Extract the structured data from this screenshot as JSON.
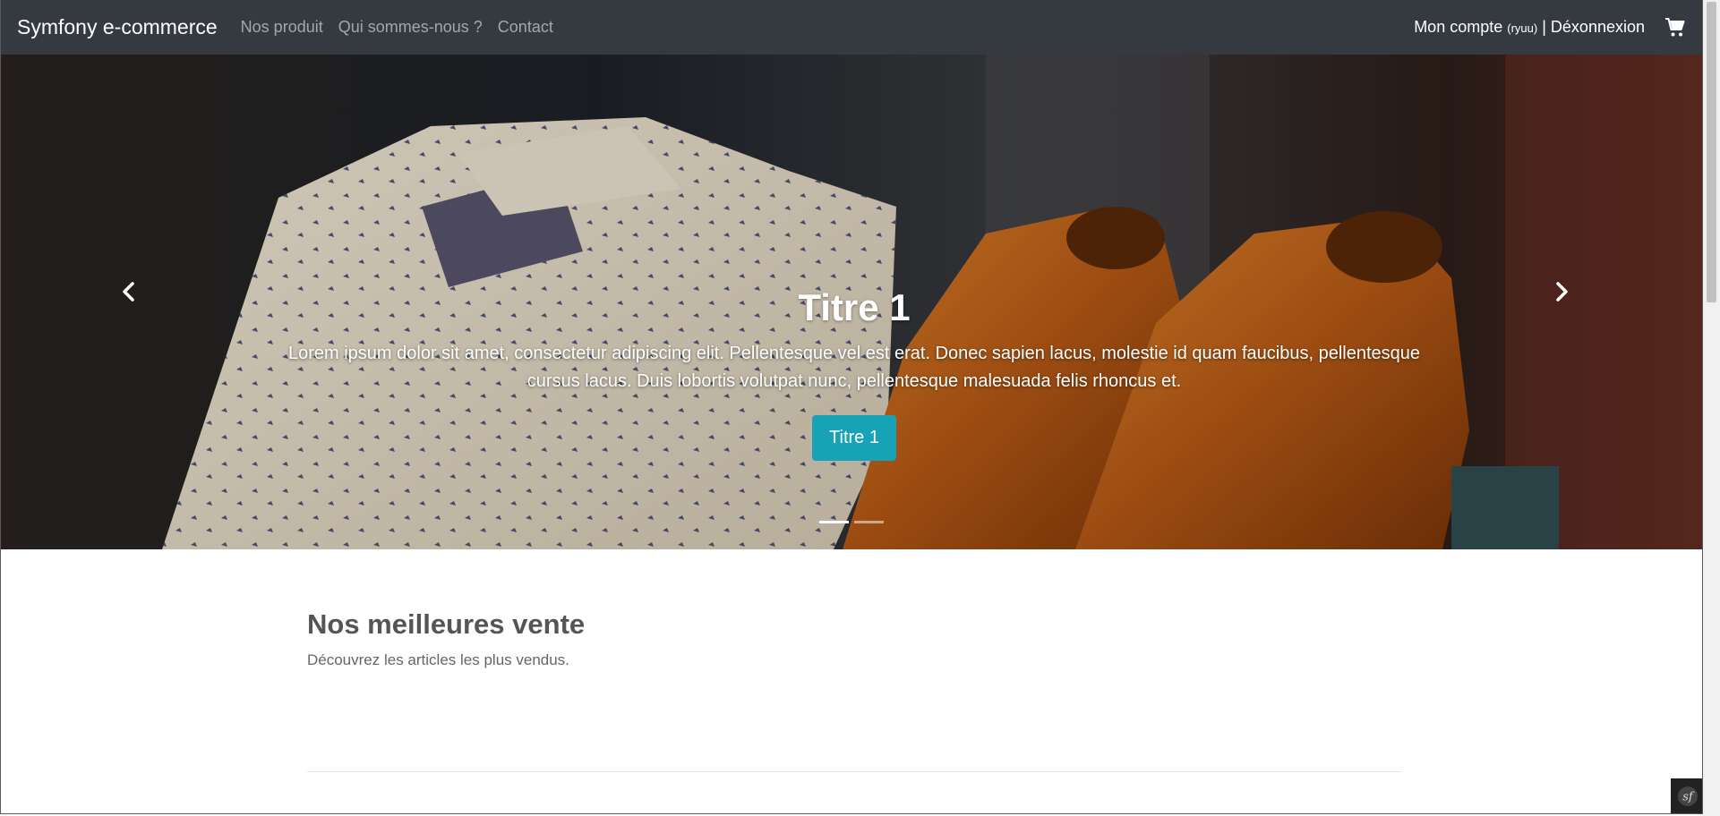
{
  "navbar": {
    "brand": "Symfony e-commerce",
    "links": [
      "Nos produit",
      "Qui sommes-nous ?",
      "Contact"
    ],
    "account_label": "Mon compte",
    "username": "(ryuu)",
    "separator": "|",
    "logout_label": "Déxonnexion",
    "cart_icon": "cart-icon"
  },
  "carousel": {
    "title": "Titre 1",
    "text": "Lorem ipsum dolor sit amet, consectetur adipiscing elit. Pellentesque vel est erat. Donec sapien lacus, molestie id quam faucibus, pellentesque cursus lacus. Duis lobortis volutpat nunc, pellentesque malesuada felis rhoncus et.",
    "button_label": "Titre 1",
    "prev_icon": "chevron-left-icon",
    "next_icon": "chevron-right-icon",
    "slides_total": 2,
    "active_slide": 1
  },
  "bestsellers": {
    "title": "Nos meilleures vente",
    "subtitle": "Découvrez les articles les plus vendus."
  },
  "colors": {
    "navbar_bg": "#343a40",
    "accent": "#17a2b8",
    "heading": "#555555"
  }
}
